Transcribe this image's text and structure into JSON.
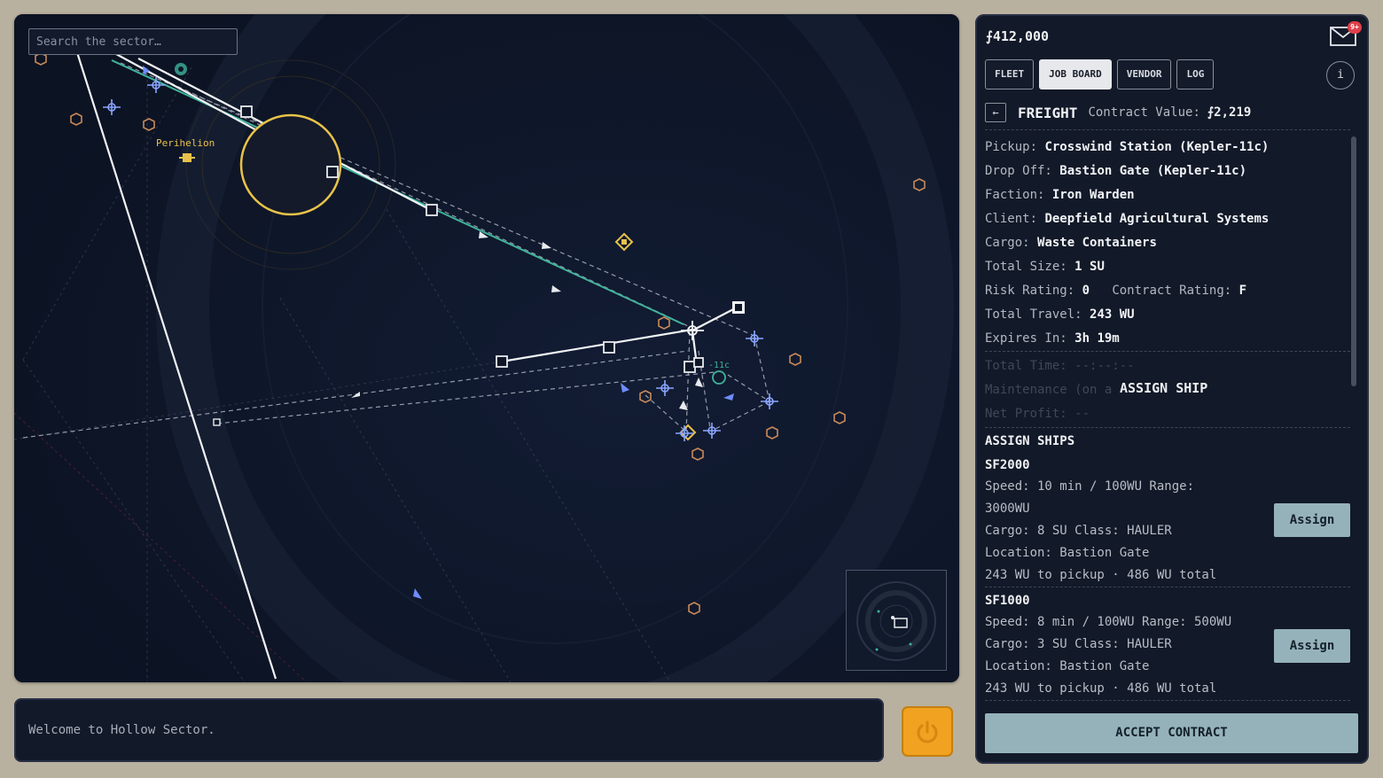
{
  "map": {
    "search_placeholder": "Search the sector…",
    "star_label": "Perihelion",
    "station_label": "-11c"
  },
  "console": {
    "message": "Welcome to Hollow Sector."
  },
  "side": {
    "credits": "⨍412,000",
    "mail_badge": "9+",
    "tabs": [
      {
        "label": "FLEET",
        "active": false
      },
      {
        "label": "JOB BOARD",
        "active": true
      },
      {
        "label": "VENDOR",
        "active": false
      },
      {
        "label": "LOG",
        "active": false
      }
    ],
    "info_label": "i",
    "back_label": "←",
    "contract": {
      "kind": "FREIGHT",
      "value_label": "Contract Value:",
      "value": "⨍2,219"
    },
    "details": [
      {
        "k": "Pickup:",
        "v": "Crosswind Station (Kepler-11c)"
      },
      {
        "k": "Drop Off:",
        "v": "Bastion Gate (Kepler-11c)"
      },
      {
        "k": "Faction:",
        "v": "Iron Warden"
      },
      {
        "k": "Client:",
        "v": "Deepfield Agricultural Systems"
      },
      {
        "k": "Cargo:",
        "v": "Waste Containers"
      },
      {
        "k": "Total Size:",
        "v": "1 SU"
      },
      {
        "k": "Risk Rating:",
        "v": "0",
        "k2": "Contract Rating:",
        "v2": "F"
      },
      {
        "k": "Total Travel:",
        "v": "243 WU"
      },
      {
        "k": "Expires In:",
        "v": "3h 19m"
      }
    ],
    "faded": [
      {
        "k": "Total Time:",
        "v": "--:--:--"
      },
      {
        "k": "Maintenance (on a",
        "v": ""
      },
      {
        "k": "Net Profit:",
        "v": "--"
      }
    ],
    "assign_ship_overlay": "ASSIGN SHIP",
    "assign_ships_title": "ASSIGN SHIPS",
    "ships": [
      {
        "name": "SF2000",
        "speed": "Speed: 10 min / 100WU   Range:",
        "range_wrap": "3000WU",
        "cargo": "Cargo: 8 SU   Class: HAULER",
        "location": "Location: Bastion Gate",
        "distance": "243 WU to pickup  ·  486 WU total",
        "button": "Assign"
      },
      {
        "name": "SF1000",
        "speed": "Speed: 8 min / 100WU   Range: 500WU",
        "cargo": "Cargo: 3 SU   Class: HAULER",
        "location": "Location: Bastion Gate",
        "distance": "243 WU to pickup  ·  486 WU total",
        "button": "Assign"
      }
    ],
    "accept_label": "ACCEPT CONTRACT"
  },
  "colors": {
    "map_bg": "#0f1628",
    "panel_bg": "#121928",
    "star": "#e8c24a",
    "route_teal": "#3fb39b",
    "accent_button": "#95b2bb",
    "power_orange": "#f0a220",
    "hazard": "#c98a5a"
  }
}
